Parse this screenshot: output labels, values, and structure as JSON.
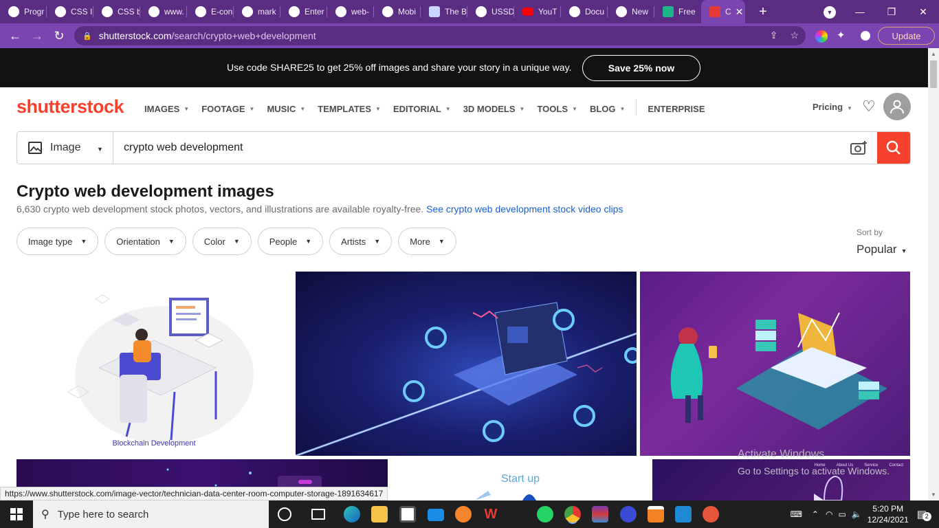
{
  "browser": {
    "tabs": [
      {
        "label": "Progr"
      },
      {
        "label": "CSS I"
      },
      {
        "label": "CSS b"
      },
      {
        "label": "www."
      },
      {
        "label": "E-con"
      },
      {
        "label": "mark"
      },
      {
        "label": "Enter"
      },
      {
        "label": "web-"
      },
      {
        "label": "Mobi"
      },
      {
        "label": "The B"
      },
      {
        "label": "USSD"
      },
      {
        "label": "YouT"
      },
      {
        "label": "Docu"
      },
      {
        "label": "New"
      },
      {
        "label": "Free"
      },
      {
        "label": "C"
      }
    ],
    "new_tab_glyph": "+",
    "url_domain": "shutterstock.com",
    "url_path": "/search/crypto+web+development",
    "update_label": "Update",
    "status_url": "https://www.shutterstock.com/image-vector/technician-data-center-room-computer-storage-1891634617"
  },
  "promo": {
    "text": "Use code SHARE25 to get 25% off images and share your story in a unique way.",
    "button": "Save 25% now"
  },
  "header": {
    "logo": "shutterstock",
    "nav": [
      {
        "label": "IMAGES"
      },
      {
        "label": "FOOTAGE"
      },
      {
        "label": "MUSIC"
      },
      {
        "label": "TEMPLATES"
      },
      {
        "label": "EDITORIAL"
      },
      {
        "label": "3D MODELS"
      },
      {
        "label": "TOOLS"
      },
      {
        "label": "BLOG"
      },
      {
        "label": "ENTERPRISE"
      }
    ],
    "pricing": "Pricing"
  },
  "search": {
    "type_label": "Image",
    "query": "crypto web development"
  },
  "results": {
    "title": "Crypto web development images",
    "subtitle": "6,630 crypto web development stock photos, vectors, and illustrations are available royalty-free.",
    "video_link": "See crypto web development stock video clips",
    "filters": [
      {
        "label": "Image type"
      },
      {
        "label": "Orientation"
      },
      {
        "label": "Color"
      },
      {
        "label": "People"
      },
      {
        "label": "Artists"
      },
      {
        "label": "More"
      }
    ],
    "sort_label": "Sort by",
    "sort_value": "Popular",
    "tile1_caption": "Blockchain Development",
    "tile5_caption": "Start up",
    "tile6_nav": [
      "Home",
      "About Us",
      "Service",
      "Contact"
    ]
  },
  "windows": {
    "watermark_title": "Activate Windows",
    "watermark_sub": "Go to Settings to activate Windows.",
    "search_placeholder": "Type here to search",
    "time": "5:20 PM",
    "date": "12/24/2021",
    "notification_count": "2"
  },
  "colors": {
    "brand": "#f5412d",
    "browser_frame": "#5a2d82",
    "link": "#1a5fd6"
  }
}
